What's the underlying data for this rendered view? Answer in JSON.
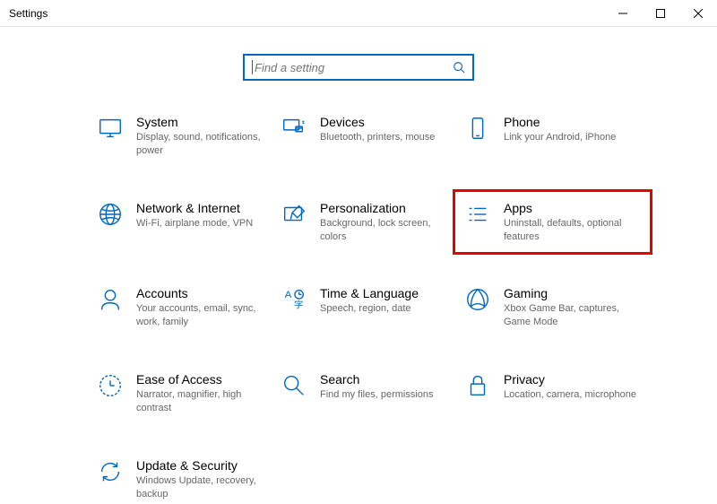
{
  "window": {
    "title": "Settings"
  },
  "search": {
    "placeholder": "Find a setting"
  },
  "tiles": {
    "system": {
      "title": "System",
      "desc": "Display, sound, notifications, power"
    },
    "devices": {
      "title": "Devices",
      "desc": "Bluetooth, printers, mouse"
    },
    "phone": {
      "title": "Phone",
      "desc": "Link your Android, iPhone"
    },
    "network": {
      "title": "Network & Internet",
      "desc": "Wi-Fi, airplane mode, VPN"
    },
    "personalization": {
      "title": "Personalization",
      "desc": "Background, lock screen, colors"
    },
    "apps": {
      "title": "Apps",
      "desc": "Uninstall, defaults, optional features"
    },
    "accounts": {
      "title": "Accounts",
      "desc": "Your accounts, email, sync, work, family"
    },
    "time": {
      "title": "Time & Language",
      "desc": "Speech, region, date"
    },
    "gaming": {
      "title": "Gaming",
      "desc": "Xbox Game Bar, captures, Game Mode"
    },
    "ease": {
      "title": "Ease of Access",
      "desc": "Narrator, magnifier, high contrast"
    },
    "search_cat": {
      "title": "Search",
      "desc": "Find my files, permissions"
    },
    "privacy": {
      "title": "Privacy",
      "desc": "Location, camera, microphone"
    },
    "update": {
      "title": "Update & Security",
      "desc": "Windows Update, recovery, backup"
    }
  }
}
